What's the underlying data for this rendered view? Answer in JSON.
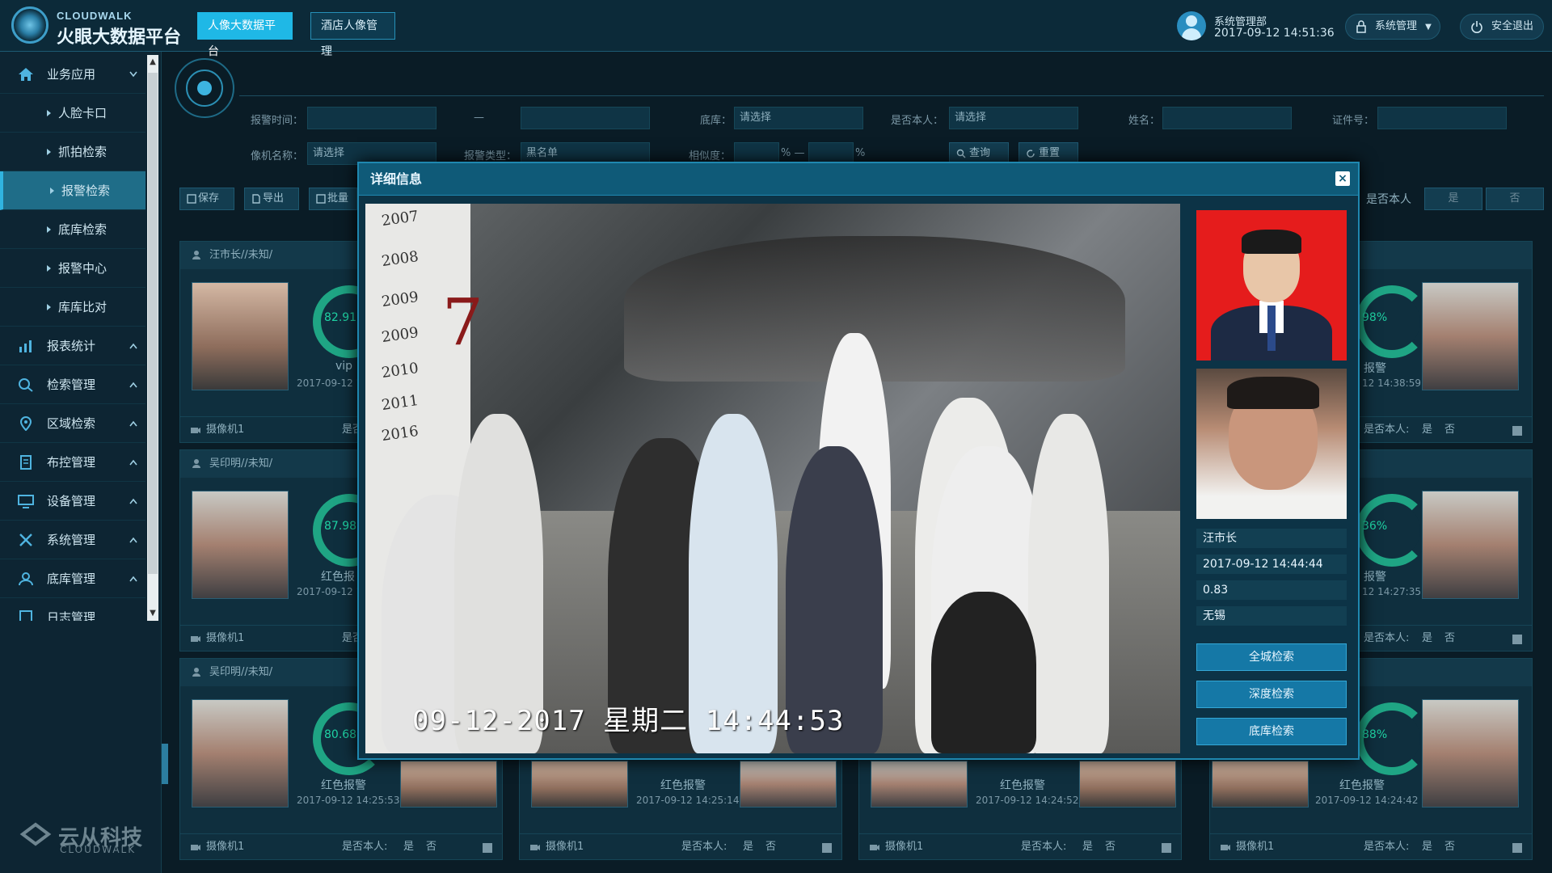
{
  "header": {
    "logo_en": "CLOUDWALK",
    "logo_cn": "火眼大数据平台",
    "nav": [
      "人像大数据平台",
      "酒店人像管理"
    ],
    "user_dept": "系统管理部",
    "user_time": "2017-09-12 14:51:36",
    "system_menu": "系统管理",
    "logout": "安全退出"
  },
  "sidebar": {
    "items": [
      {
        "label": "业务应用"
      },
      {
        "label": "人脸卡口"
      },
      {
        "label": "抓拍检索"
      },
      {
        "label": "报警检索"
      },
      {
        "label": "底库检索"
      },
      {
        "label": "报警中心"
      },
      {
        "label": "库库比对"
      },
      {
        "label": "报表统计"
      },
      {
        "label": "检索管理"
      },
      {
        "label": "区域检索"
      },
      {
        "label": "布控管理"
      },
      {
        "label": "设备管理"
      },
      {
        "label": "系统管理"
      },
      {
        "label": "底库管理"
      },
      {
        "label": "日志管理"
      }
    ],
    "footer_cn": "云从科技",
    "footer_en": "CLOUDWALK"
  },
  "filters": {
    "alarm_time_label": "报警时间：",
    "dash": "—",
    "library_label": "底库：",
    "library_value": "请选择",
    "is_self_label": "是否本人：",
    "is_self_value": "请选择",
    "name_label": "姓名：",
    "id_label": "证件号：",
    "camera_label": "像机名称：",
    "camera_value": "请选择",
    "alarm_type_label": "报警类型：",
    "alarm_type_value": "黑名单",
    "similarity_label": "相似度：",
    "pct_sep": "% —",
    "pct": "%",
    "query_btn": "查询",
    "reset_btn": "重置"
  },
  "toolbar": {
    "save": "保存",
    "export": "导出",
    "batch": "批量",
    "is_self_label": "是否本人",
    "yes": "是",
    "no": "否"
  },
  "cards": [
    {
      "title": "汪市长//未知/",
      "score": "82.91",
      "type": "vip",
      "time": "2017-09-12 1"
    },
    {
      "title": "",
      "score": "98%",
      "type": "报警",
      "time": "12 14:38:59"
    },
    {
      "title": "吴印明//未知/",
      "score": "87.98",
      "type": "红色报",
      "time": "2017-09-12 1"
    },
    {
      "title": "",
      "score": "36%",
      "type": "报警",
      "time": "12 14:27:35"
    },
    {
      "title": "吴印明//未知/",
      "score": "80.68",
      "type": "红色报警",
      "time": "2017-09-12 14:25:53"
    },
    {
      "title": "",
      "score": "",
      "type": "红色报警",
      "time": "2017-09-12 14:25:14"
    },
    {
      "title": "",
      "score": "",
      "type": "红色报警",
      "time": "2017-09-12 14:24:52"
    },
    {
      "title": "",
      "score": "88%",
      "type": "红色报警",
      "time": "2017-09-12 14:24:42"
    }
  ],
  "card_foot": {
    "camera": "摄像机1",
    "self_label": "是否本人:",
    "yes": "是",
    "no": "否"
  },
  "modal": {
    "title": "详细信息",
    "close": "×",
    "timestamp": "09-12-2017  星期二  14:44:53",
    "name": "汪市长",
    "time": "2017-09-12 14:44:44",
    "score": "0.83",
    "location": "无锡",
    "btn_city": "全城检索",
    "btn_deep": "深度检索",
    "btn_lib": "底库检索",
    "years": [
      "2007",
      "2008",
      "2009",
      "2009",
      "2010",
      "2011",
      "2016"
    ],
    "big_number": "7"
  },
  "colors": {
    "accent": "#1fb8e6",
    "ring": "#1fa584",
    "alarm_red": "#e51c1c"
  }
}
